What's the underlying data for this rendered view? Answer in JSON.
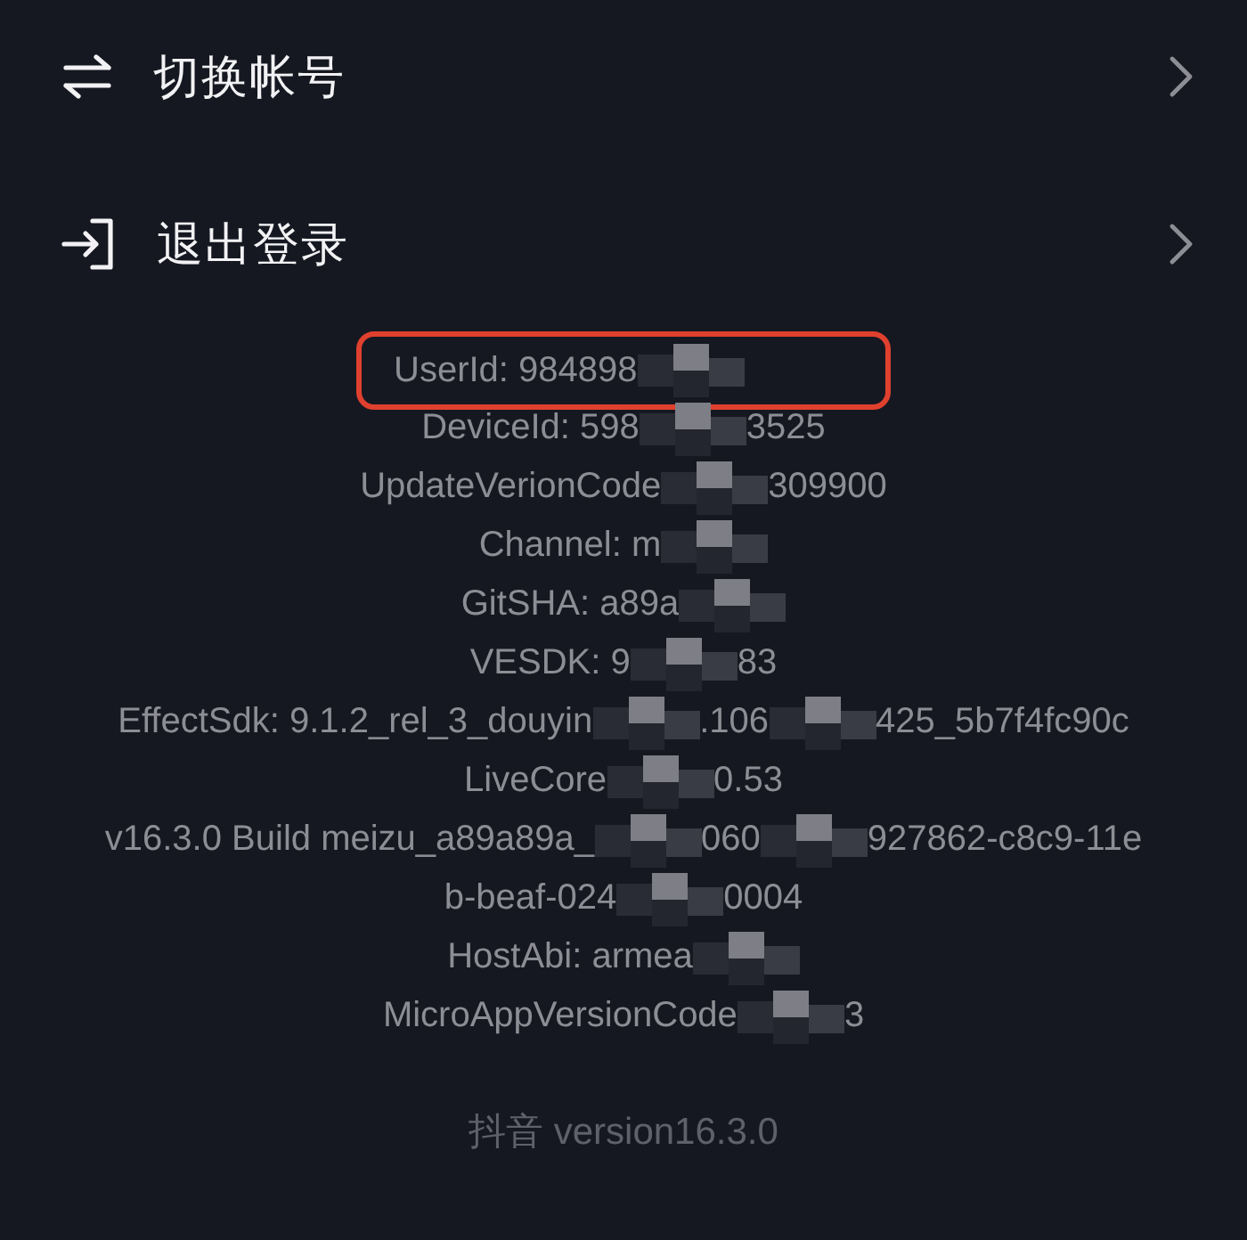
{
  "menu": [
    {
      "kind": "switch",
      "label": "切换帐号"
    },
    {
      "kind": "logout",
      "label": "退出登录"
    }
  ],
  "info_lines": [
    {
      "parts": [
        "UserId: 984898"
      ],
      "highlighted": true
    },
    {
      "parts": [
        "DeviceId: 598",
        "3525"
      ],
      "highlighted": false
    },
    {
      "parts": [
        "UpdateVerionCode",
        "309900"
      ],
      "highlighted": false
    },
    {
      "parts": [
        "Channel: m"
      ],
      "highlighted": false
    },
    {
      "parts": [
        "GitSHA: a89a"
      ],
      "highlighted": false
    },
    {
      "parts": [
        "VESDK: 9",
        "83"
      ],
      "highlighted": false
    },
    {
      "parts": [
        "EffectSdk: 9.1.2_rel_3_douyin",
        ".106",
        "425_5b7f4fc90c"
      ],
      "highlighted": false
    },
    {
      "parts": [
        "LiveCore",
        "0.53"
      ],
      "highlighted": false
    },
    {
      "parts": [
        "v16.3.0 Build meizu_a89a89a_",
        "060",
        "927862-c8c9-11e"
      ],
      "highlighted": false
    },
    {
      "parts": [
        "b-beaf-024",
        "0004"
      ],
      "highlighted": false
    },
    {
      "parts": [
        "HostAbi: armea"
      ],
      "highlighted": false
    },
    {
      "parts": [
        "MicroAppVersionCode",
        "3"
      ],
      "highlighted": false
    }
  ],
  "footer": "抖音 version16.3.0"
}
